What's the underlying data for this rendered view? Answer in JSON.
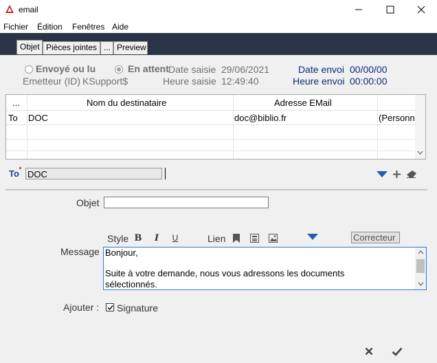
{
  "window": {
    "title": "email"
  },
  "menu": [
    "Fichier",
    "Édition",
    "Fenêtres",
    "Aide"
  ],
  "tabs": [
    {
      "label": "Objet",
      "active": true
    },
    {
      "label": "Pièces jointes",
      "active": false
    },
    {
      "label": "...",
      "active": false
    },
    {
      "label": "Preview",
      "active": false
    }
  ],
  "status": {
    "sent_label": "Envoyé ou lu",
    "waiting_label": "En attente",
    "selected": "En attente"
  },
  "sender": {
    "label": "Emetteur (ID)",
    "value": "KSupport$"
  },
  "entry": {
    "date_label": "Date saisie",
    "date_value": "29/06/2021",
    "time_label": "Heure saisie",
    "time_value": "12:49:40"
  },
  "send": {
    "date_label": "Date envoi",
    "date_value": "00/00/00",
    "time_label": "Heure envoi",
    "time_value": "00:00:00"
  },
  "recipients": {
    "columns": [
      "...",
      "Nom du destinataire",
      "Adresse EMail",
      ""
    ],
    "rows": [
      {
        "type": "To",
        "name": "DOC",
        "email": "doc@biblio.fr",
        "extra": "(Personne)"
      }
    ]
  },
  "to_line": {
    "label": "To",
    "value": "DOC"
  },
  "subject": {
    "label": "Objet",
    "value": ""
  },
  "formatting": {
    "style_label": "Style",
    "bold": "B",
    "italic": "I",
    "underline": "U",
    "link_label": "Lien",
    "corrector_label": "Correcteur"
  },
  "message": {
    "label": "Message",
    "lines": [
      "Bonjour,",
      "",
      "Suite à votre demande, nous vous adressons les documents",
      "sélectionnés."
    ]
  },
  "add": {
    "label": "Ajouter :",
    "signature_label": "Signature",
    "signature_checked": true
  },
  "colors": {
    "tabstrip_bg": "#2b3446",
    "label_blue": "#0a2a7c",
    "accent_blue": "#1f5fb0"
  }
}
